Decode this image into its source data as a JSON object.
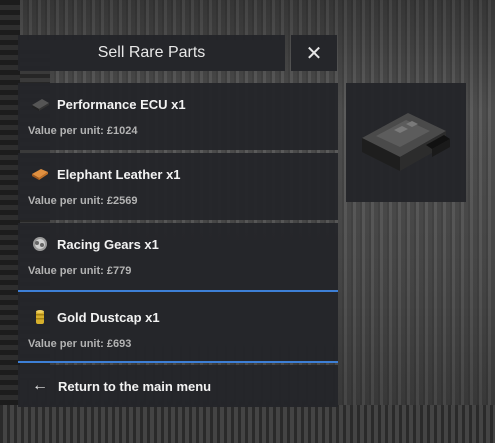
{
  "header": {
    "title": "Sell Rare Parts",
    "close_icon": "✕"
  },
  "items": [
    {
      "name": "Performance ECU x1",
      "value": "Value per unit: £1024",
      "icon": "ecu-icon"
    },
    {
      "name": "Elephant Leather x1",
      "value": "Value per unit: £2569",
      "icon": "leather-icon"
    },
    {
      "name": "Racing Gears x1",
      "value": "Value per unit: £779",
      "icon": "gears-icon"
    },
    {
      "name": "Gold Dustcap x1",
      "value": "Value per unit: £693",
      "icon": "dustcap-icon"
    }
  ],
  "footer": {
    "return_label": "Return to the main menu",
    "arrow_icon": "←"
  },
  "colors": {
    "panel": "#242529",
    "accent": "#3d7fd6"
  }
}
